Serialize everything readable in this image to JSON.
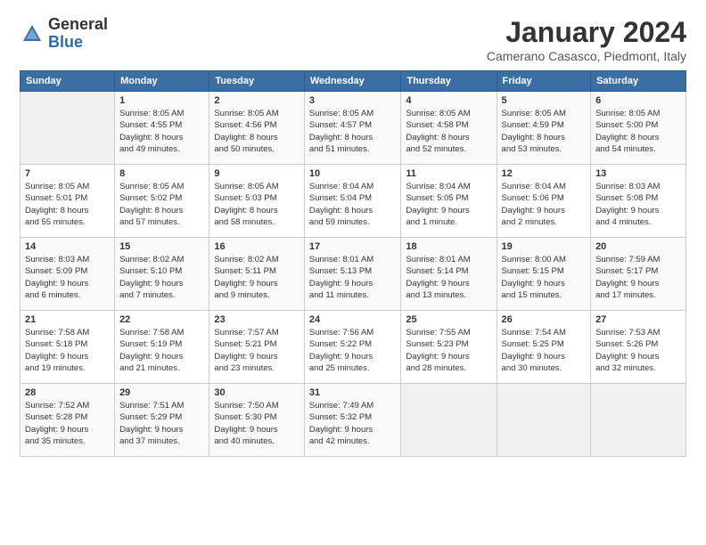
{
  "logo": {
    "general": "General",
    "blue": "Blue"
  },
  "title": "January 2024",
  "subtitle": "Camerano Casasco, Piedmont, Italy",
  "headers": [
    "Sunday",
    "Monday",
    "Tuesday",
    "Wednesday",
    "Thursday",
    "Friday",
    "Saturday"
  ],
  "weeks": [
    [
      {
        "day": "",
        "info": ""
      },
      {
        "day": "1",
        "info": "Sunrise: 8:05 AM\nSunset: 4:55 PM\nDaylight: 8 hours\nand 49 minutes."
      },
      {
        "day": "2",
        "info": "Sunrise: 8:05 AM\nSunset: 4:56 PM\nDaylight: 8 hours\nand 50 minutes."
      },
      {
        "day": "3",
        "info": "Sunrise: 8:05 AM\nSunset: 4:57 PM\nDaylight: 8 hours\nand 51 minutes."
      },
      {
        "day": "4",
        "info": "Sunrise: 8:05 AM\nSunset: 4:58 PM\nDaylight: 8 hours\nand 52 minutes."
      },
      {
        "day": "5",
        "info": "Sunrise: 8:05 AM\nSunset: 4:59 PM\nDaylight: 8 hours\nand 53 minutes."
      },
      {
        "day": "6",
        "info": "Sunrise: 8:05 AM\nSunset: 5:00 PM\nDaylight: 8 hours\nand 54 minutes."
      }
    ],
    [
      {
        "day": "7",
        "info": "Sunrise: 8:05 AM\nSunset: 5:01 PM\nDaylight: 8 hours\nand 55 minutes."
      },
      {
        "day": "8",
        "info": "Sunrise: 8:05 AM\nSunset: 5:02 PM\nDaylight: 8 hours\nand 57 minutes."
      },
      {
        "day": "9",
        "info": "Sunrise: 8:05 AM\nSunset: 5:03 PM\nDaylight: 8 hours\nand 58 minutes."
      },
      {
        "day": "10",
        "info": "Sunrise: 8:04 AM\nSunset: 5:04 PM\nDaylight: 8 hours\nand 59 minutes."
      },
      {
        "day": "11",
        "info": "Sunrise: 8:04 AM\nSunset: 5:05 PM\nDaylight: 9 hours\nand 1 minute."
      },
      {
        "day": "12",
        "info": "Sunrise: 8:04 AM\nSunset: 5:06 PM\nDaylight: 9 hours\nand 2 minutes."
      },
      {
        "day": "13",
        "info": "Sunrise: 8:03 AM\nSunset: 5:08 PM\nDaylight: 9 hours\nand 4 minutes."
      }
    ],
    [
      {
        "day": "14",
        "info": "Sunrise: 8:03 AM\nSunset: 5:09 PM\nDaylight: 9 hours\nand 6 minutes."
      },
      {
        "day": "15",
        "info": "Sunrise: 8:02 AM\nSunset: 5:10 PM\nDaylight: 9 hours\nand 7 minutes."
      },
      {
        "day": "16",
        "info": "Sunrise: 8:02 AM\nSunset: 5:11 PM\nDaylight: 9 hours\nand 9 minutes."
      },
      {
        "day": "17",
        "info": "Sunrise: 8:01 AM\nSunset: 5:13 PM\nDaylight: 9 hours\nand 11 minutes."
      },
      {
        "day": "18",
        "info": "Sunrise: 8:01 AM\nSunset: 5:14 PM\nDaylight: 9 hours\nand 13 minutes."
      },
      {
        "day": "19",
        "info": "Sunrise: 8:00 AM\nSunset: 5:15 PM\nDaylight: 9 hours\nand 15 minutes."
      },
      {
        "day": "20",
        "info": "Sunrise: 7:59 AM\nSunset: 5:17 PM\nDaylight: 9 hours\nand 17 minutes."
      }
    ],
    [
      {
        "day": "21",
        "info": "Sunrise: 7:58 AM\nSunset: 5:18 PM\nDaylight: 9 hours\nand 19 minutes."
      },
      {
        "day": "22",
        "info": "Sunrise: 7:58 AM\nSunset: 5:19 PM\nDaylight: 9 hours\nand 21 minutes."
      },
      {
        "day": "23",
        "info": "Sunrise: 7:57 AM\nSunset: 5:21 PM\nDaylight: 9 hours\nand 23 minutes."
      },
      {
        "day": "24",
        "info": "Sunrise: 7:56 AM\nSunset: 5:22 PM\nDaylight: 9 hours\nand 25 minutes."
      },
      {
        "day": "25",
        "info": "Sunrise: 7:55 AM\nSunset: 5:23 PM\nDaylight: 9 hours\nand 28 minutes."
      },
      {
        "day": "26",
        "info": "Sunrise: 7:54 AM\nSunset: 5:25 PM\nDaylight: 9 hours\nand 30 minutes."
      },
      {
        "day": "27",
        "info": "Sunrise: 7:53 AM\nSunset: 5:26 PM\nDaylight: 9 hours\nand 32 minutes."
      }
    ],
    [
      {
        "day": "28",
        "info": "Sunrise: 7:52 AM\nSunset: 5:28 PM\nDaylight: 9 hours\nand 35 minutes."
      },
      {
        "day": "29",
        "info": "Sunrise: 7:51 AM\nSunset: 5:29 PM\nDaylight: 9 hours\nand 37 minutes."
      },
      {
        "day": "30",
        "info": "Sunrise: 7:50 AM\nSunset: 5:30 PM\nDaylight: 9 hours\nand 40 minutes."
      },
      {
        "day": "31",
        "info": "Sunrise: 7:49 AM\nSunset: 5:32 PM\nDaylight: 9 hours\nand 42 minutes."
      },
      {
        "day": "",
        "info": ""
      },
      {
        "day": "",
        "info": ""
      },
      {
        "day": "",
        "info": ""
      }
    ]
  ]
}
